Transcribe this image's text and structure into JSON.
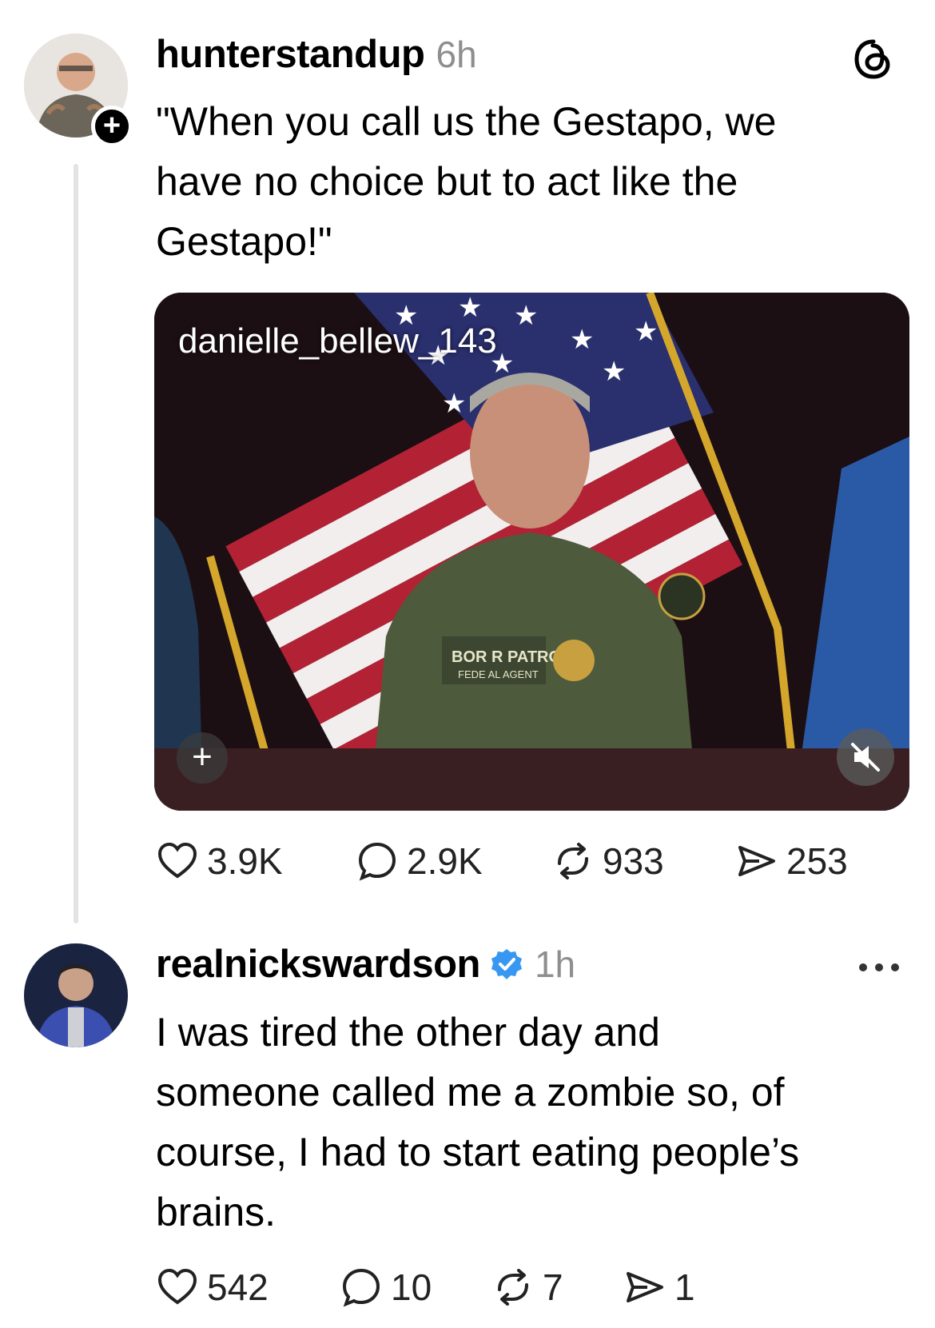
{
  "post1": {
    "username": "hunterstandup",
    "time": "6h",
    "text_line1": "\"When you call us the Gestapo, we",
    "text_line2": "have no choice but to act like the",
    "text_line3": "Gestapo!\"",
    "video": {
      "handle": "danielle_bellew_143",
      "badge_text_1": "BOR  R PATROL",
      "badge_text_2": "FEDE  AL AGENT"
    },
    "stats": {
      "likes": "3.9K",
      "replies": "2.9K",
      "reposts": "933",
      "shares": "253"
    }
  },
  "post2": {
    "username": "realnickswardson",
    "time": "1h",
    "text_line1": "I was tired the other day and",
    "text_line2": "someone called me a zombie so, of",
    "text_line3": "course, I had to start eating people’s",
    "text_line4": "brains.",
    "stats": {
      "likes": "542",
      "replies": "10",
      "reposts": "7",
      "shares": "1"
    }
  },
  "colors": {
    "verified": "#3897f0",
    "muted_text": "#8e8e8e",
    "thread_line": "#e3e3e3"
  }
}
